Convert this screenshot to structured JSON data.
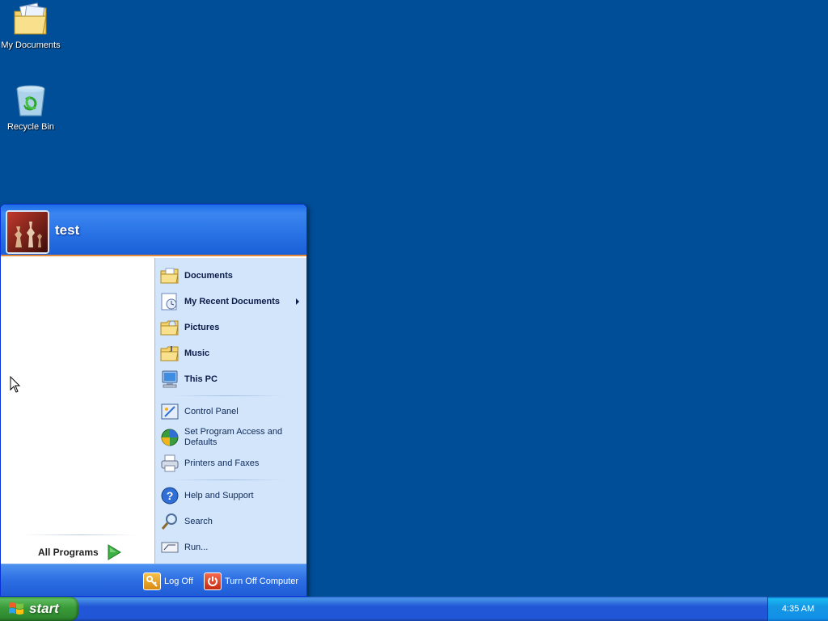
{
  "desktop": {
    "icons": [
      {
        "label": "My Documents",
        "icon": "folder-documents-icon"
      },
      {
        "label": "Recycle Bin",
        "icon": "recycle-bin-icon"
      }
    ]
  },
  "start_menu": {
    "username": "test",
    "avatar": "chess-avatar",
    "all_programs_label": "All Programs",
    "right_items": [
      {
        "label": "Documents",
        "icon": "folder-icon",
        "bold": true
      },
      {
        "label": "My Recent Documents",
        "icon": "recent-documents-icon",
        "bold": true,
        "submenu": true
      },
      {
        "label": "Pictures",
        "icon": "pictures-folder-icon",
        "bold": true
      },
      {
        "label": "Music",
        "icon": "music-folder-icon",
        "bold": true
      },
      {
        "label": "This PC",
        "icon": "computer-icon",
        "bold": true
      },
      {
        "label": "Control Panel",
        "icon": "control-panel-icon"
      },
      {
        "label": "Set Program Access and Defaults",
        "icon": "program-access-icon"
      },
      {
        "label": "Printers and Faxes",
        "icon": "printer-icon"
      },
      {
        "label": "Help and Support",
        "icon": "help-icon"
      },
      {
        "label": "Search",
        "icon": "search-icon"
      },
      {
        "label": "Run...",
        "icon": "run-icon"
      }
    ],
    "footer": {
      "log_off_label": "Log Off",
      "turn_off_label": "Turn Off Computer"
    }
  },
  "taskbar": {
    "start_label": "start",
    "clock": "4:35 AM"
  },
  "colors": {
    "desktop": "#004e98",
    "menu_header": "#2a74e6",
    "menu_right": "#d3e5fa",
    "start_green": "#3a9b3a",
    "tray": "#1597e3"
  }
}
